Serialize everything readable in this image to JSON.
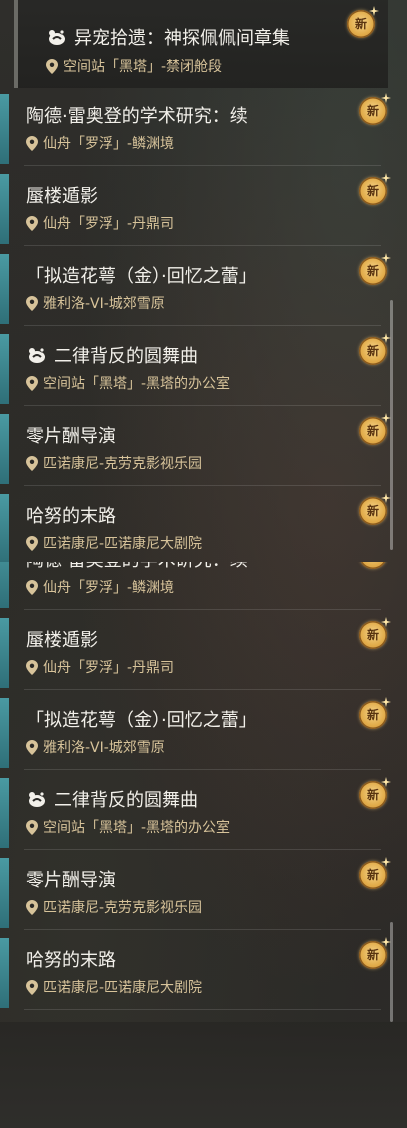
{
  "first_mission": {
    "title": "异宠拾遗：神探佩佩间章集",
    "location": "空间站「黑塔」-禁闭舱段",
    "badge": "新"
  },
  "list_a": [
    {
      "title": "陶德·雷奥登的学术研究：续",
      "location": "仙舟「罗浮」-鳞渊境",
      "badge": "新",
      "icon": ""
    },
    {
      "title": "蜃楼遁影",
      "location": "仙舟「罗浮」-丹鼎司",
      "badge": "新",
      "icon": ""
    },
    {
      "title": "「拟造花萼（金）·回忆之蕾」",
      "location": "雅利洛-VI-城郊雪原",
      "badge": "新",
      "icon": ""
    },
    {
      "title": "二律背反的圆舞曲",
      "location": "空间站「黑塔」-黑塔的办公室",
      "badge": "新",
      "icon": "pet-paw-icon"
    },
    {
      "title": "零片酬导演",
      "location": "匹诺康尼-克劳克影视乐园",
      "badge": "新",
      "icon": ""
    },
    {
      "title": "哈努的末路",
      "location": "匹诺康尼-匹诺康尼大剧院",
      "badge": "新",
      "icon": ""
    }
  ],
  "list_b": [
    {
      "title": "陶德·雷奥登的学术研究：续",
      "location": "仙舟「罗浮」-鳞渊境",
      "badge": "新",
      "icon": ""
    },
    {
      "title": "蜃楼遁影",
      "location": "仙舟「罗浮」-丹鼎司",
      "badge": "新",
      "icon": ""
    },
    {
      "title": "「拟造花萼（金）·回忆之蕾」",
      "location": "雅利洛-VI-城郊雪原",
      "badge": "新",
      "icon": ""
    },
    {
      "title": "二律背反的圆舞曲",
      "location": "空间站「黑塔」-黑塔的办公室",
      "badge": "新",
      "icon": "pet-paw-icon"
    },
    {
      "title": "零片酬导演",
      "location": "匹诺康尼-克劳克影视乐园",
      "badge": "新",
      "icon": ""
    },
    {
      "title": "哈努的末路",
      "location": "匹诺康尼-匹诺康尼大剧院",
      "badge": "新",
      "icon": ""
    }
  ],
  "colors": {
    "accent": "#4a9aa2",
    "title_text": "#f2f0ea",
    "location_text": "#d7c39a",
    "badge_gold": "#e2ad4c"
  }
}
